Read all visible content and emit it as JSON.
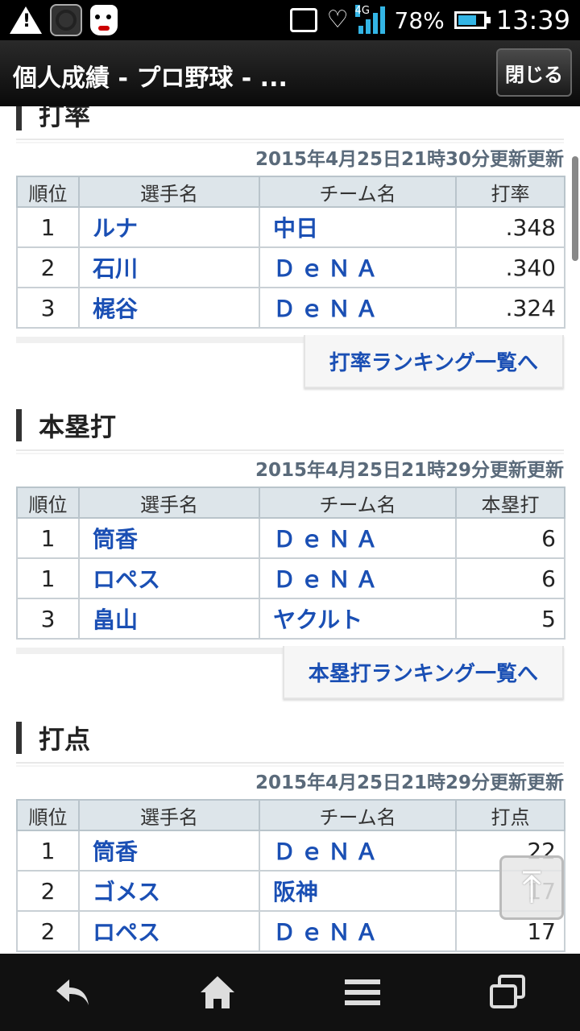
{
  "status_bar": {
    "battery_percent": "78%",
    "time": "13:39",
    "network": "4G",
    "icons": [
      "warning-icon",
      "app-icon",
      "dog-icon",
      "inbox-icon",
      "heart-icon",
      "signal-icon",
      "battery-icon"
    ]
  },
  "appbar": {
    "title": "個人成績 - プロ野球 - ...",
    "close_label": "閉じる"
  },
  "columns": {
    "rank": "順位",
    "player": "選手名",
    "team": "チーム名"
  },
  "sections": [
    {
      "title": "打率",
      "updated": "2015年4月25日21時30分更新更新",
      "stat_label": "打率",
      "rows": [
        {
          "rank": "1",
          "player": "ルナ",
          "team": "中日",
          "stat": ".348"
        },
        {
          "rank": "2",
          "player": "石川",
          "team": "ＤｅＮＡ",
          "stat": ".340"
        },
        {
          "rank": "3",
          "player": "梶谷",
          "team": "ＤｅＮＡ",
          "stat": ".324"
        }
      ],
      "more_label": "打率ランキング一覧へ"
    },
    {
      "title": "本塁打",
      "updated": "2015年4月25日21時29分更新更新",
      "stat_label": "本塁打",
      "rows": [
        {
          "rank": "1",
          "player": "筒香",
          "team": "ＤｅＮＡ",
          "stat": "6"
        },
        {
          "rank": "1",
          "player": "ロペス",
          "team": "ＤｅＮＡ",
          "stat": "6"
        },
        {
          "rank": "3",
          "player": "畠山",
          "team": "ヤクルト",
          "stat": "5"
        }
      ],
      "more_label": "本塁打ランキング一覧へ"
    },
    {
      "title": "打点",
      "updated": "2015年4月25日21時29分更新更新",
      "stat_label": "打点",
      "rows": [
        {
          "rank": "1",
          "player": "筒香",
          "team": "ＤｅＮＡ",
          "stat": "22"
        },
        {
          "rank": "2",
          "player": "ゴメス",
          "team": "阪神",
          "stat": "17"
        },
        {
          "rank": "2",
          "player": "ロペス",
          "team": "ＤｅＮＡ",
          "stat": "17"
        }
      ]
    }
  ],
  "floating": {
    "icon": "arrow-up-icon"
  },
  "nav": {
    "icons": [
      "back-icon",
      "home-icon",
      "menu-icon",
      "recent-apps-icon"
    ]
  }
}
